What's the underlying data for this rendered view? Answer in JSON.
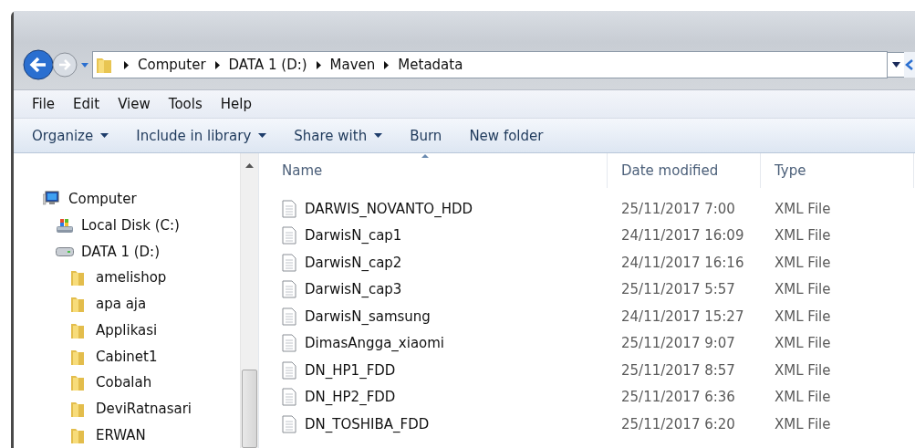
{
  "address_bar": {
    "crumbs": [
      "Computer",
      "DATA 1 (D:)",
      "Maven",
      "Metadata"
    ]
  },
  "menu_bar": [
    "File",
    "Edit",
    "View",
    "Tools",
    "Help"
  ],
  "toolbar": [
    {
      "label": "Organize",
      "dropdown": true
    },
    {
      "label": "Include in library",
      "dropdown": true
    },
    {
      "label": "Share with",
      "dropdown": true
    },
    {
      "label": "Burn",
      "dropdown": false
    },
    {
      "label": "New folder",
      "dropdown": false
    }
  ],
  "navigation_pane": {
    "items": [
      {
        "label": "Computer",
        "kind": "computer",
        "children": [
          {
            "label": "Local Disk (C:)",
            "kind": "system-drive"
          },
          {
            "label": "DATA 1 (D:)",
            "kind": "drive",
            "children": [
              {
                "label": "amelishop",
                "kind": "folder"
              },
              {
                "label": "apa aja",
                "kind": "folder"
              },
              {
                "label": "Applikasi",
                "kind": "folder"
              },
              {
                "label": "Cabinet1",
                "kind": "folder"
              },
              {
                "label": "Cobalah",
                "kind": "folder"
              },
              {
                "label": "DeviRatnasari",
                "kind": "folder"
              },
              {
                "label": "ERWAN",
                "kind": "folder"
              }
            ]
          }
        ]
      }
    ]
  },
  "file_list": {
    "columns": [
      "Name",
      "Date modified",
      "Type"
    ],
    "rows": [
      {
        "name": "DARWIS_NOVANTO_HDD",
        "date": "25/11/2017 7:00",
        "type": "XML File"
      },
      {
        "name": "DarwisN_cap1",
        "date": "24/11/2017 16:09",
        "type": "XML File"
      },
      {
        "name": "DarwisN_cap2",
        "date": "24/11/2017 16:16",
        "type": "XML File"
      },
      {
        "name": "DarwisN_cap3",
        "date": "25/11/2017 5:57",
        "type": "XML File"
      },
      {
        "name": "DarwisN_samsung",
        "date": "24/11/2017 15:27",
        "type": "XML File"
      },
      {
        "name": "DimasAngga_xiaomi",
        "date": "25/11/2017 9:07",
        "type": "XML File"
      },
      {
        "name": "DN_HP1_FDD",
        "date": "25/11/2017 8:57",
        "type": "XML File"
      },
      {
        "name": "DN_HP2_FDD",
        "date": "25/11/2017 6:36",
        "type": "XML File"
      },
      {
        "name": "DN_TOSHIBA_FDD",
        "date": "25/11/2017 6:20",
        "type": "XML File"
      }
    ]
  }
}
